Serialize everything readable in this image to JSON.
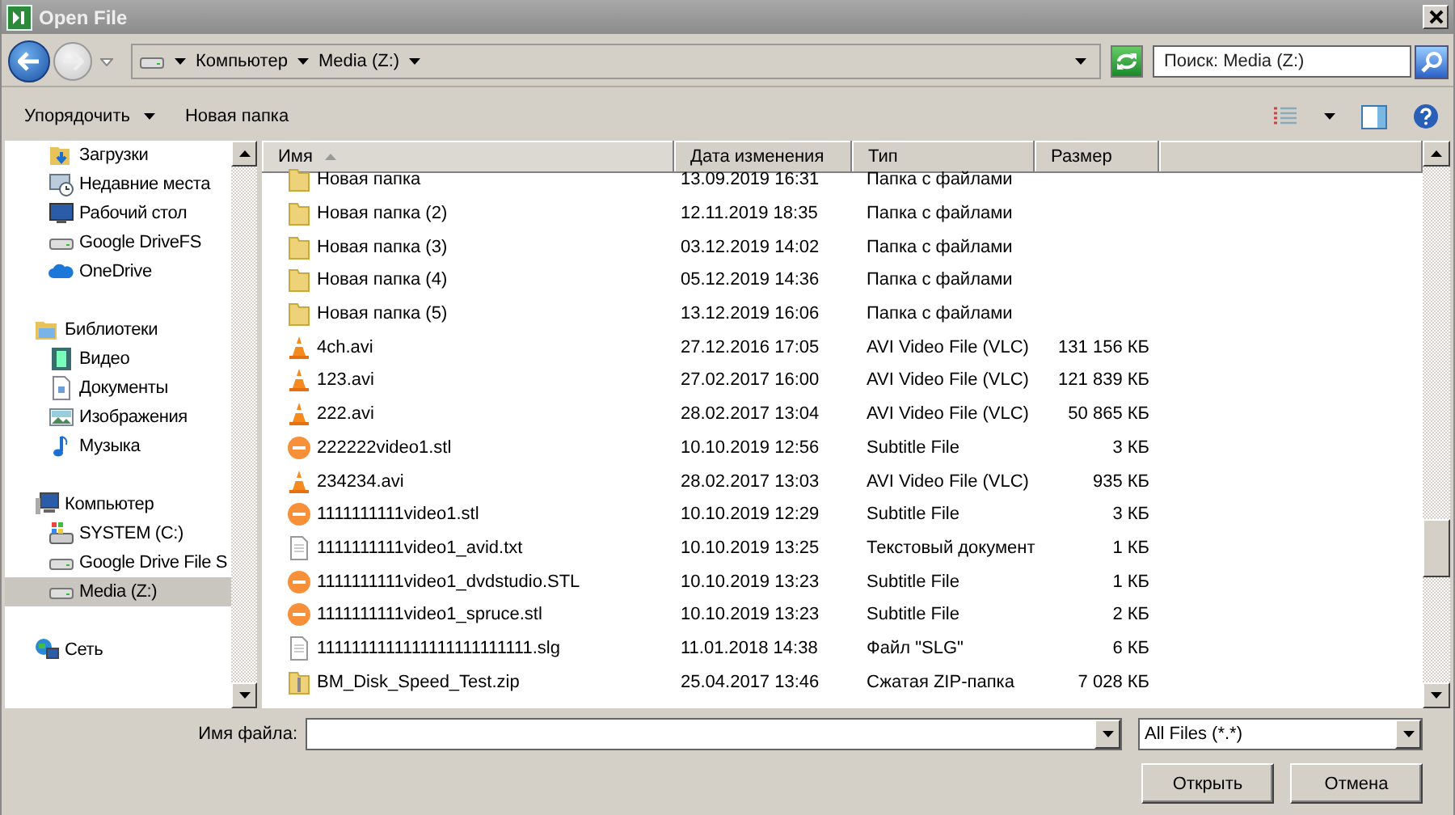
{
  "window": {
    "title": "Open File"
  },
  "address": {
    "path": [
      {
        "label": "Компьютер"
      },
      {
        "label": "Media (Z:)"
      }
    ]
  },
  "search": {
    "placeholder": "Поиск: Media (Z:)"
  },
  "toolbar": {
    "buttons": [
      {
        "label": "Упорядочить",
        "kind": "menu"
      },
      {
        "label": "Новая папка",
        "kind": "plain"
      }
    ]
  },
  "sidebar": {
    "sections": [
      {
        "items": [
          {
            "label": "Загрузки",
            "kind": "downloads",
            "selected": false
          },
          {
            "label": "Недавние места",
            "kind": "recent",
            "selected": false
          },
          {
            "label": "Рабочий стол",
            "kind": "desktop",
            "selected": false
          },
          {
            "label": "Google DriveFS",
            "kind": "drive",
            "selected": false
          },
          {
            "label": "OneDrive",
            "kind": "cloud",
            "selected": false
          }
        ]
      },
      {
        "label": "Библиотеки",
        "kind": "library",
        "selected": false,
        "children": [
          {
            "label": "Видео",
            "kind": "video",
            "selected": false
          },
          {
            "label": "Документы",
            "kind": "document",
            "selected": false
          },
          {
            "label": "Изображения",
            "kind": "image",
            "selected": false
          },
          {
            "label": "Музыка",
            "kind": "music",
            "selected": false
          }
        ]
      },
      {
        "label": "Компьютер",
        "kind": "computer",
        "selected": false,
        "children": [
          {
            "label": "SYSTEM (C:)",
            "kind": "system",
            "selected": false
          },
          {
            "label": "Google Drive File S",
            "kind": "drive",
            "selected": false
          },
          {
            "label": "Media (Z:)",
            "kind": "drive",
            "selected": true
          }
        ]
      },
      {
        "label": "Сеть",
        "kind": "network",
        "selected": false
      }
    ]
  },
  "table": {
    "columns": [
      {
        "label": "Имя",
        "sorted": true
      },
      {
        "label": "Дата изменения",
        "sorted": false
      },
      {
        "label": "Тип",
        "sorted": false
      },
      {
        "label": "Размер",
        "sorted": false
      }
    ],
    "rows": [
      {
        "name": "Новая папка",
        "date": "13.09.2019 16:31",
        "type": "Папка с файлами",
        "kind": "folder"
      },
      {
        "name": "Новая папка (2)",
        "date": "12.11.2019 18:35",
        "type": "Папка с файлами",
        "kind": "folder"
      },
      {
        "name": "Новая папка (3)",
        "date": "03.12.2019 14:02",
        "type": "Папка с файлами",
        "kind": "folder"
      },
      {
        "name": "Новая папка (4)",
        "date": "05.12.2019 14:36",
        "type": "Папка с файлами",
        "kind": "folder"
      },
      {
        "name": "Новая папка (5)",
        "date": "13.12.2019 16:06",
        "type": "Папка с файлами",
        "kind": "folder"
      },
      {
        "name": "4ch.avi",
        "date": "27.12.2016 17:05",
        "type": "AVI Video File (VLC)",
        "size": "131 156 КБ",
        "kind": "video"
      },
      {
        "name": "123.avi",
        "date": "27.02.2017 16:00",
        "type": "AVI Video File (VLC)",
        "size": "121 839 КБ",
        "kind": "video"
      },
      {
        "name": "222.avi",
        "date": "28.02.2017 13:04",
        "type": "AVI Video File (VLC)",
        "size": "50 865 КБ",
        "kind": "video"
      },
      {
        "name": "222222video1.stl",
        "date": "10.10.2019 12:56",
        "type": "Subtitle File",
        "size": "3 КБ",
        "kind": "subtitle"
      },
      {
        "name": "234234.avi",
        "date": "28.02.2017 13:03",
        "type": "AVI Video File (VLC)",
        "size": "935 КБ",
        "kind": "video"
      },
      {
        "name": "1111111111video1.stl",
        "date": "10.10.2019 12:29",
        "type": "Subtitle File",
        "size": "3 КБ",
        "kind": "subtitle"
      },
      {
        "name": "1111111111video1_avid.txt",
        "date": "10.10.2019 13:25",
        "type": "Текстовый документ",
        "size": "1 КБ",
        "kind": "text"
      },
      {
        "name": "1111111111video1_dvdstudio.STL",
        "date": "10.10.2019 13:23",
        "type": "Subtitle File",
        "size": "1 КБ",
        "kind": "subtitle"
      },
      {
        "name": "1111111111video1_spruce.stl",
        "date": "10.10.2019 13:23",
        "type": "Subtitle File",
        "size": "2 КБ",
        "kind": "subtitle"
      },
      {
        "name": "1111111111111111111111111.slg",
        "date": "11.01.2018 14:38",
        "type": "Файл \"SLG\"",
        "size": "6 КБ",
        "kind": "text"
      },
      {
        "name": "BM_Disk_Speed_Test.zip",
        "date": "25.04.2017 13:46",
        "type": "Сжатая ZIP-папка",
        "size": "7 028 КБ",
        "kind": "zip"
      }
    ]
  },
  "filename": {
    "label": "Имя файла:"
  },
  "filter": {
    "value": "All Files (*.*)"
  },
  "buttons": [
    {
      "label": "Открыть"
    },
    {
      "label": "Отмена"
    }
  ]
}
